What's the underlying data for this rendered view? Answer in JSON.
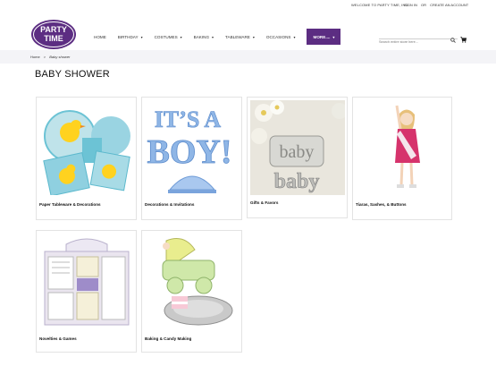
{
  "topbar": {
    "welcome": "WELCOME TO PARTY TIME, INC.",
    "sign_in": "SIGN IN",
    "or": "OR",
    "create_account": "CREATE AN ACCOUNT"
  },
  "logo": {
    "line1": "PARTY",
    "line2": "TIME"
  },
  "nav": {
    "items": [
      {
        "label": "HOME",
        "has_chevron": false
      },
      {
        "label": "BIRTHDAY",
        "has_chevron": true
      },
      {
        "label": "COSTUMES",
        "has_chevron": true
      },
      {
        "label": "BAKING",
        "has_chevron": true
      },
      {
        "label": "TABLEWARE",
        "has_chevron": true
      },
      {
        "label": "OCCASIONS",
        "has_chevron": true
      }
    ],
    "more_label": "MORE....",
    "more_color": "#5c2d82"
  },
  "search": {
    "placeholder": "Search entire store here..."
  },
  "breadcrumb": {
    "home": "Home",
    "separator": ">",
    "current": "Baby shower"
  },
  "page_title": "BABY SHOWER",
  "categories": [
    {
      "label": "Paper Tableware & Decorations",
      "icon": "rubber-duck-plates-image"
    },
    {
      "label": "Decorations & Invitations",
      "icon": "its-a-boy-centerpiece-image"
    },
    {
      "label": "Gifts & Favors",
      "icon": "baby-silver-favors-image"
    },
    {
      "label": "Tiaras, Sashes, & Buttons",
      "icon": "girl-with-sash-image"
    },
    {
      "label": "Novelties & Games",
      "icon": "baby-shower-game-kit-image"
    },
    {
      "label": "Baking & Candy Making",
      "icon": "baby-carriage-cake-pan-image"
    }
  ]
}
